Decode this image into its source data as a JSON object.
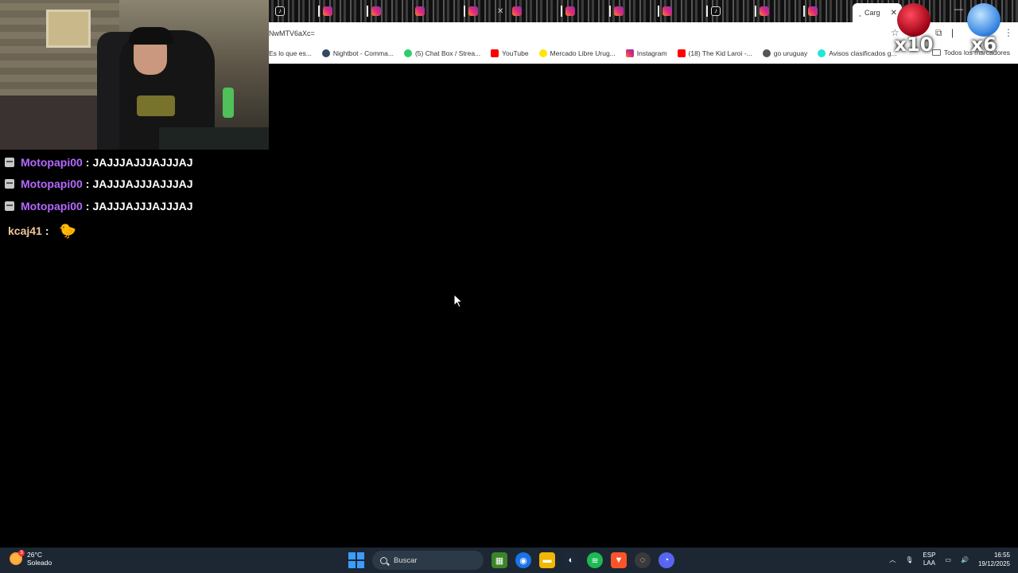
{
  "browser": {
    "url_fragment": "NwMTV6aXc=",
    "active_tab_title": "Carg",
    "bookmarks": [
      {
        "label": "Es lo que es...",
        "icon": "page-icon",
        "color": "#888888"
      },
      {
        "label": "Nightbot - Comma...",
        "icon": "nightbot-icon",
        "color": "#34495e"
      },
      {
        "label": "(5) Chat Box / Strea...",
        "icon": "chatbox-icon",
        "color": "#2ecc71"
      },
      {
        "label": "YouTube",
        "icon": "youtube-icon",
        "color": "#ff0000"
      },
      {
        "label": "Mercado Libre Urug...",
        "icon": "mercadolibre-icon",
        "color": "#ffe600"
      },
      {
        "label": "Instagram",
        "icon": "instagram-icon",
        "color": "#dd2a7b"
      },
      {
        "label": "(18) The Kid Laroi -...",
        "icon": "youtube-icon",
        "color": "#ff0000"
      },
      {
        "label": "go uruguay",
        "icon": "globe-icon",
        "color": "#555555"
      },
      {
        "label": "Avisos clasificados g...",
        "icon": "olx-icon",
        "color": "#23e5db"
      }
    ],
    "all_bookmarks_label": "Todos los marcadores"
  },
  "alerts": [
    {
      "count": "x10",
      "color": "#c4001a",
      "icon": "red-orb-icon"
    },
    {
      "count": "x6",
      "color": "#2f7fe0",
      "icon": "blue-orb-icon"
    }
  ],
  "chat": {
    "messages": [
      {
        "user": "Motopapi00",
        "separator": ":",
        "text": "JAJJJAJJJAJJJAJ",
        "user_color": "#b569ff"
      },
      {
        "user": "Motopapi00",
        "separator": ":",
        "text": "JAJJJAJJJAJJJAJ",
        "user_color": "#b569ff"
      },
      {
        "user": "Motopapi00",
        "separator": ":",
        "text": "JAJJJAJJJAJJJAJ",
        "user_color": "#b569ff"
      },
      {
        "user": "kcaj41",
        "separator": ":",
        "text": "",
        "emote": "🐤",
        "user_color": "#f0c79a"
      }
    ]
  },
  "taskbar": {
    "weather_temp": "26°C",
    "weather_desc": "Soleado",
    "weather_badge": "3",
    "search_placeholder": "Buscar",
    "lang_line1": "ESP",
    "lang_line2": "LAA",
    "time": "16:55",
    "date": "19/12/2025",
    "apps": [
      {
        "name": "minecraft-icon",
        "color": "#3c8527",
        "glyph": "▦"
      },
      {
        "name": "chrome-icon",
        "color": "#1a73e8",
        "glyph": "◉"
      },
      {
        "name": "file-explorer-icon",
        "color": "#f2b705",
        "glyph": "▬"
      },
      {
        "name": "steam-icon",
        "color": "#1b2838",
        "glyph": "◐"
      },
      {
        "name": "spotify-icon",
        "color": "#1db954",
        "glyph": "≋"
      },
      {
        "name": "brave-icon",
        "color": "#fb542b",
        "glyph": "▼"
      },
      {
        "name": "obs-icon",
        "color": "#3a3a3a",
        "glyph": "◌"
      },
      {
        "name": "discord-icon",
        "color": "#5865f2",
        "glyph": "◔"
      }
    ]
  }
}
